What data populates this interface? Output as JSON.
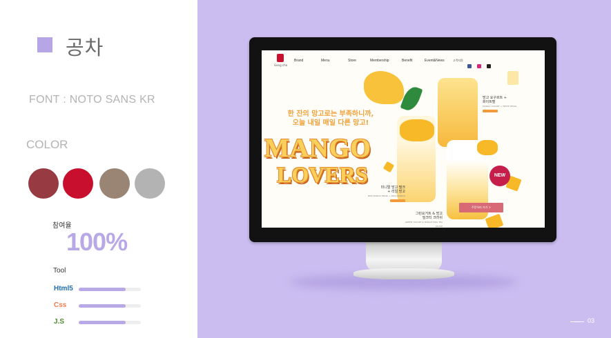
{
  "title": "공차",
  "font_label": "FONT : NOTO SANS KR",
  "color_label": "COLOR",
  "colors": [
    "#973a42",
    "#c8102e",
    "#9a8474",
    "#b3b3b3"
  ],
  "participation": {
    "label": "참여율",
    "value": "100%"
  },
  "tool": {
    "label": "Tool",
    "items": [
      {
        "name": "Html5",
        "color": "#1f6fb5",
        "level": 0.75
      },
      {
        "name": "Css",
        "color": "#f07850",
        "level": 0.75
      },
      {
        "name": "J.S",
        "color": "#4a8a2a",
        "level": 0.75
      }
    ]
  },
  "site": {
    "logo_text": "Gong cha",
    "nav": [
      "Brand",
      "Menu",
      "Store",
      "Membership",
      "Benefit",
      "Event&News"
    ],
    "lang": "고객지원",
    "slogan_line1": "한 잔의 망고로는 부족하니까,",
    "slogan_line2": "오늘 내일 매일 다른 망고!",
    "hero_line1": "MANGO",
    "hero_line2": "LOVERS",
    "products": [
      {
        "name": "망고 요구르트 +",
        "name2": "화이트펄",
        "sub": "MANGO YOGURT + WHITE PEARL"
      },
      {
        "name": "미니멀 망고 펄크",
        "name2": "+ 리얼 망고",
        "sub": "MINI MANGO PEARL + REAL MANGO"
      },
      {
        "name": "그린요거트 & 망고",
        "name2": "밀크티 크러쉬",
        "sub": "GREEN YOGURT & MANGO MILK TEA CRUSH"
      }
    ],
    "badge": "NEW",
    "cta": "주문하러 가기 >"
  },
  "page_number": "03"
}
